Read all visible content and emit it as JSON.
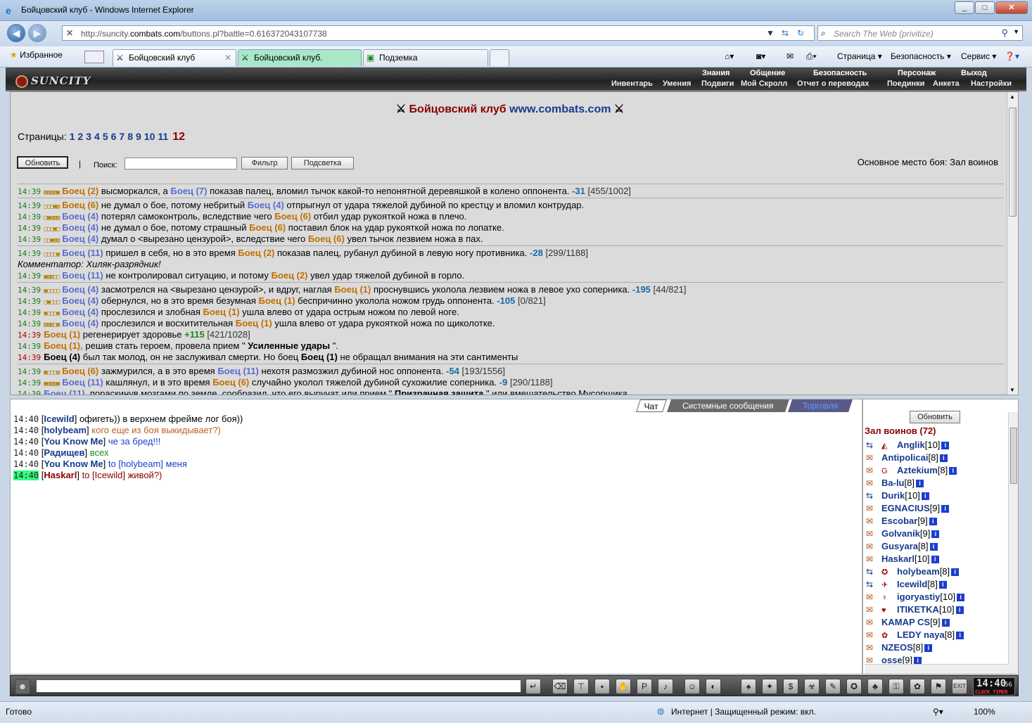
{
  "window": {
    "title": "Бойцовский клуб - Windows Internet Explorer",
    "buttons": [
      "_",
      "□",
      "✕"
    ]
  },
  "address": {
    "url_prefix": "http://suncity.",
    "url_domain": "combats.com",
    "url_suffix": "/buttons.pl?battle=0.616372043107738"
  },
  "search": {
    "placeholder": "Search The Web (privitize)"
  },
  "favorites": {
    "label": "Избранное"
  },
  "tabs": [
    {
      "label": "Бойцовский клуб",
      "active": true
    },
    {
      "label": "Бойцовский клуб."
    },
    {
      "label": "Подземка"
    }
  ],
  "commandbar": {
    "page": "Страница",
    "safety": "Безопасность",
    "service": "Сервис"
  },
  "game": {
    "logo": "SUNCITY",
    "menu_top": [
      "Знания",
      "Общение",
      "Безопасность",
      "Персонаж",
      "Выход"
    ],
    "menu_sub": [
      "Инвентарь",
      "Умения",
      "Подвиги",
      "Мой Скролл",
      "Отчет о переводах",
      "Поединки",
      "Анкета",
      "Настройки"
    ]
  },
  "main": {
    "title_club": "Бойцовский клуб",
    "title_site": "www.combats.com",
    "pages_label": "Страницы:",
    "pages": [
      "1",
      "2",
      "3",
      "4",
      "5",
      "6",
      "7",
      "8",
      "9",
      "10",
      "11"
    ],
    "current_page": "12",
    "refresh_label": "Обновить",
    "divider": "|",
    "search_label": "Поиск:",
    "filter_label": "Фильтр",
    "highlight_label": "Подсветка",
    "place_text": "Основное место боя: Зал воинов"
  },
  "log": [
    [
      {
        "t": "14:39",
        "sq": "▨▨▨▨▣",
        "parts": [
          [
            "o",
            "Боец (2)"
          ],
          [
            "",
            "высморкался, а"
          ],
          [
            "b",
            "Боец (7)"
          ],
          [
            "",
            "показав палец, вломил тычок какой-то непонятной деревяшкой в колено оппонента."
          ],
          [
            "dmg",
            "-31"
          ],
          [
            "hp",
            "[455/1002]"
          ]
        ]
      }
    ],
    [
      {
        "t": "14:39",
        "sq": "□□□▣▨",
        "parts": [
          [
            "o",
            "Боец (6)"
          ],
          [
            "",
            "не думал о бое, потому небритый"
          ],
          [
            "b",
            "Боец (4)"
          ],
          [
            "",
            "отпрыгнул от удара тяжелой дубиной по крестцу и вломил контрудар."
          ]
        ]
      },
      {
        "t": "14:39",
        "sq": "□▣▨▨▨",
        "parts": [
          [
            "b",
            "Боец (4)"
          ],
          [
            "",
            "потерял самоконтроль, вследствие чего"
          ],
          [
            "o",
            "Боец (6)"
          ],
          [
            "",
            "отбил удар рукояткой ножа в плечо."
          ]
        ]
      },
      {
        "t": "14:39",
        "sq": "□□□▣□",
        "parts": [
          [
            "b",
            "Боец (4)"
          ],
          [
            "",
            "не думал о бое, потому страшный"
          ],
          [
            "o",
            "Боец (6)"
          ],
          [
            "",
            "поставил блок на удар рукояткой ножа по лопатке."
          ]
        ]
      },
      {
        "t": "14:39",
        "sq": "□□▣▨▨",
        "parts": [
          [
            "b",
            "Боец (4)"
          ],
          [
            "",
            "думал о <вырезано цензурой>, вследствие чего"
          ],
          [
            "o",
            "Боец (6)"
          ],
          [
            "",
            "увел тычок лезвием ножа в пах."
          ]
        ]
      }
    ],
    [
      {
        "t": "14:39",
        "sq": "□□□□▣",
        "parts": [
          [
            "b",
            "Боец (11)"
          ],
          [
            "",
            "пришел в себя, но в это время"
          ],
          [
            "o",
            "Боец (2)"
          ],
          [
            "",
            "показав палец, рубанул дубиной в левую ногу противника."
          ],
          [
            "dmg",
            "-28"
          ],
          [
            "hp",
            "[299/1188]"
          ]
        ]
      },
      {
        "comment": "Комментатор: Хиляк-разрядник!"
      },
      {
        "t": "14:39",
        "sq": "▣▨▨□□",
        "parts": [
          [
            "b",
            "Боец (11)"
          ],
          [
            "",
            "не контролировал ситуацию, и потому"
          ],
          [
            "o",
            "Боец (2)"
          ],
          [
            "",
            "увел удар тяжелой дубиной в горло."
          ]
        ]
      }
    ],
    [
      {
        "t": "14:39",
        "sq": "▣□□□□",
        "parts": [
          [
            "b",
            "Боец (4)"
          ],
          [
            "",
            "засмотрелся на <вырезано цензурой>, и вдруг, наглая"
          ],
          [
            "o",
            "Боец (1)"
          ],
          [
            "",
            "проснувшись уколола лезвием ножа в левое ухо соперника."
          ],
          [
            "dmg",
            "-195"
          ],
          [
            "hp",
            "[44/821]"
          ]
        ]
      },
      {
        "t": "14:39",
        "sq": "□▣□□□",
        "parts": [
          [
            "b",
            "Боец (4)"
          ],
          [
            "",
            "обернулся, но в это время безумная"
          ],
          [
            "o",
            "Боец (1)"
          ],
          [
            "",
            "беспричинно уколола ножом грудь оппонента."
          ],
          [
            "dmg",
            "-105"
          ],
          [
            "hp",
            "[0/821]"
          ]
        ]
      },
      {
        "t": "14:39",
        "sq": "▣□□□▣",
        "parts": [
          [
            "b",
            "Боец (4)"
          ],
          [
            "",
            "прослезился и злобная"
          ],
          [
            "o",
            "Боец (1)"
          ],
          [
            "",
            "ушла влево от удара острым ножом по левой ноге."
          ]
        ]
      },
      {
        "t": "14:39",
        "sq": "▨▨▨□▣",
        "parts": [
          [
            "b",
            "Боец (4)"
          ],
          [
            "",
            "прослезился и восхитительная"
          ],
          [
            "o",
            "Боец (1)"
          ],
          [
            "",
            "ушла влево от удара рукояткой ножа по щиколотке."
          ]
        ]
      },
      {
        "t": "14:39",
        "red": true,
        "parts": [
          [
            "o",
            "Боец (1)"
          ],
          [
            "",
            "регенерирует здоровье"
          ],
          [
            "heal",
            "+115"
          ],
          [
            "hp",
            "[421/1028]"
          ]
        ]
      },
      {
        "t": "14:39",
        "parts": [
          [
            "o",
            "Боец (1),"
          ],
          [
            "",
            "решив стать героем, провела прием \""
          ],
          [
            "bold",
            "Усиленные удары"
          ],
          [
            "",
            "\"."
          ]
        ]
      },
      {
        "t": "14:39",
        "red": true,
        "parts": [
          [
            "bold",
            "Боец (4)"
          ],
          [
            "",
            "был так молод, он не заслуживал смерти. Но боец"
          ],
          [
            "bold",
            "Боец (1)"
          ],
          [
            "",
            "не обращал внимания на эти сантименты"
          ]
        ]
      }
    ],
    [
      {
        "t": "14:39",
        "sq": "▣□□□▨",
        "parts": [
          [
            "o",
            "Боец (6)"
          ],
          [
            "",
            "зажмурился, а в это время"
          ],
          [
            "b",
            "Боец (11)"
          ],
          [
            "",
            "нехотя размозжил дубиной нос оппонента."
          ],
          [
            "dmg",
            "-54"
          ],
          [
            "hp",
            "[193/1556]"
          ]
        ]
      },
      {
        "t": "14:39",
        "sq": "▣▨▨▨▣",
        "parts": [
          [
            "b",
            "Боец (11)"
          ],
          [
            "",
            "кашлянул, и в это время"
          ],
          [
            "o",
            "Боец (6)"
          ],
          [
            "",
            "случайно уколол тяжелой дубиной сухожилие соперника."
          ],
          [
            "dmg",
            "-9"
          ],
          [
            "hp",
            "[290/1188]"
          ]
        ]
      },
      {
        "t": "14:39",
        "parts": [
          [
            "b",
            "Боец (11),"
          ],
          [
            "",
            "пораскинув мозгами по земле, сообразил, что его выручат или прием \""
          ],
          [
            "bold",
            "Призрачная защита"
          ],
          [
            "",
            "\" или вмешательство Мусорщика."
          ]
        ]
      }
    ]
  ],
  "chat": {
    "tabs": [
      "Чат",
      "Системные сообщения",
      "Торговля"
    ],
    "messages": [
      {
        "t": "14:40",
        "nick": "Icewild",
        "text": "офигеть)) в верхнем фрейме лог боя))",
        "color": "#000000"
      },
      {
        "t": "14:40",
        "nick": "holybeam",
        "text": "кого еще из боя выкидывает?)",
        "color": "#c06020"
      },
      {
        "t": "14:40",
        "nick": "You Know Me",
        "text": "че за бред!!!",
        "color": "#1a3ed0"
      },
      {
        "t": "14:40",
        "nick": "Радищев",
        "text": "всех",
        "color": "#1a8a1a"
      },
      {
        "t": "14:40",
        "nick": "You Know Me",
        "text": "to [holybeam] меня",
        "color": "#1a3ed0"
      },
      {
        "t": "14:40",
        "nick": "Haskarl",
        "text": "to [Icewild] живой?)",
        "color": "#8b0000",
        "hl": true
      }
    ]
  },
  "users": {
    "refresh_label": "Обновить",
    "title": "Зал воинов (72)",
    "list": [
      {
        "n": "Anglik",
        "lv": "[10]",
        "blue": true,
        "clan": "◭"
      },
      {
        "n": "Antipolicai",
        "lv": "[8]"
      },
      {
        "n": "Aztekium",
        "lv": "[8]",
        "clan": "G"
      },
      {
        "n": "Ba-lu",
        "lv": "[8]"
      },
      {
        "n": "Durik",
        "lv": "[10]",
        "blue": true
      },
      {
        "n": "EGNACIUS",
        "lv": "[9]"
      },
      {
        "n": "Escobar",
        "lv": "[9]"
      },
      {
        "n": "Golvanik",
        "lv": "[9]"
      },
      {
        "n": "Gusyara",
        "lv": "[8]"
      },
      {
        "n": "Haskarl",
        "lv": "[10]"
      },
      {
        "n": "holybeam",
        "lv": "[8]",
        "blue": true,
        "clan": "✪"
      },
      {
        "n": "Icewild",
        "lv": "[8]",
        "blue": true,
        "clan": "✈"
      },
      {
        "n": "igoryastiy",
        "lv": "[10]",
        "clan": "♆"
      },
      {
        "n": "ITIKETKA",
        "lv": "[10]",
        "clan": "♥"
      },
      {
        "n": "KAMAP CS",
        "lv": "[9]"
      },
      {
        "n": "LEDY naya",
        "lv": "[8]",
        "clan": "✿"
      },
      {
        "n": "NZEOS",
        "lv": "[8]"
      },
      {
        "n": "osse",
        "lv": "[9]"
      }
    ]
  },
  "clock": {
    "time": "14:40",
    "seconds": "56",
    "label": "CLOCK TIMER"
  },
  "status": {
    "left": "Готово",
    "zone": "Интернет | Защищенный режим: вкл.",
    "zoom": "100%"
  }
}
